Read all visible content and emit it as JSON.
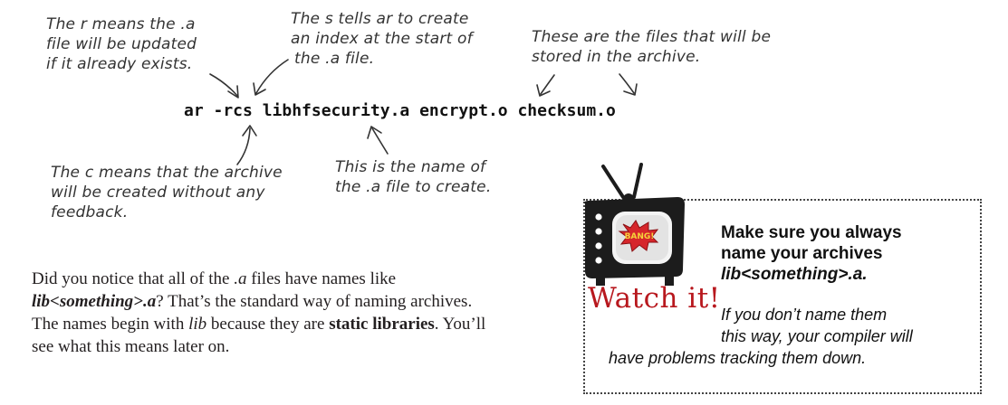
{
  "annotations": {
    "r_note": [
      "The r means the .a",
      "file will be updated",
      "if it already exists."
    ],
    "s_note": [
      "The s tells ar to create",
      "an index at the start of",
      "the .a file."
    ],
    "files_note": [
      "These are the files that will be",
      "stored in the archive."
    ],
    "c_note": [
      "The c means that the archive",
      "will be created without any",
      "feedback."
    ],
    "name_note": [
      "This is the name of",
      "the .a file to create."
    ]
  },
  "command": {
    "text": "ar -rcs libhfsecurity.a encrypt.o checksum.o"
  },
  "paragraph": {
    "part1": "Did you notice that all of the ",
    "part2": ".a",
    "part3": " files have names like ",
    "part4": "lib<something>.a",
    "part5": "? That’s the standard way of naming archives. The names begin with ",
    "part6": "lib",
    "part7": " because they are ",
    "part8": "static libraries",
    "part9": ". You’ll see what this means later on."
  },
  "warning": {
    "tv_sign": "BANG!",
    "watch_label": "Watch it!",
    "heading_line1": "Make sure you always",
    "heading_line2": "name your archives",
    "heading_line3": "lib<something>.a.",
    "body_line1": "If you don’t name them",
    "body_line2": "this way, your compiler will",
    "body_line3": "have problems tracking them down."
  },
  "colors": {
    "accent_red": "#b8181e",
    "tv_body": "#1c1c1c",
    "sign_red": "#d6262b"
  }
}
